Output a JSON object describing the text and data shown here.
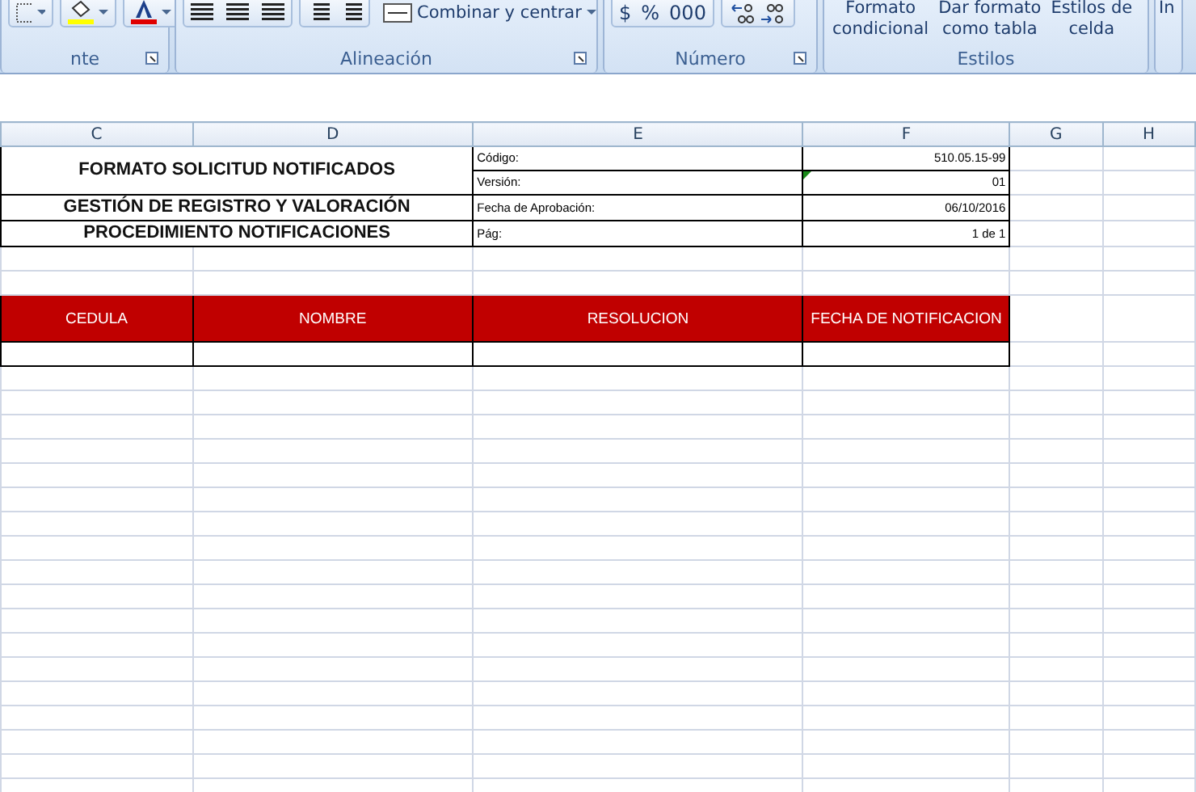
{
  "ribbon": {
    "groups": [
      {
        "kind": "font",
        "label": "nte"
      },
      {
        "kind": "align",
        "label": "Alineación",
        "merge_button": "Combinar y centrar"
      },
      {
        "kind": "number",
        "label": "Número",
        "buttons": [
          "$",
          "%",
          "000"
        ]
      },
      {
        "kind": "styles",
        "label": "Estilos",
        "buttons": [
          "Formato\ncondicional",
          "Dar formato\ncomo tabla",
          "Estilos de\ncelda"
        ]
      },
      {
        "kind": "cut",
        "label": "In"
      }
    ]
  },
  "sheet": {
    "columns": [
      "C",
      "D",
      "E",
      "F",
      "G",
      "H"
    ],
    "title": "FORMATO SOLICITUD NOTIFICADOS",
    "subtitles": [
      "GESTIÓN DE REGISTRO Y VALORACIÓN",
      "PROCEDIMIENTO NOTIFICACIONES"
    ],
    "meta": [
      {
        "label": "Código:",
        "value": "510.05.15-99"
      },
      {
        "label": "Versión:",
        "value": "01"
      },
      {
        "label": "Fecha de Aprobación:",
        "value": "06/10/2016"
      },
      {
        "label": "Pág:",
        "value": "1 de 1"
      }
    ],
    "table_headers": [
      "CEDULA",
      "NOMBRE",
      "RESOLUCION",
      "FECHA DE NOTIFICACION"
    ]
  }
}
